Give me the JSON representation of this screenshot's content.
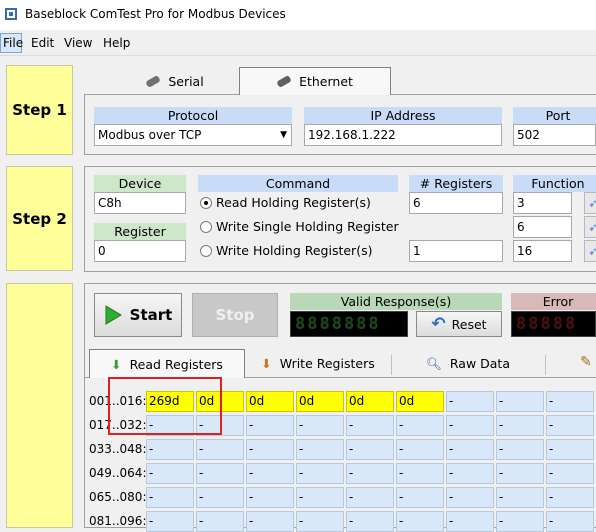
{
  "window": {
    "title": "Baseblock ComTest Pro for Modbus Devices"
  },
  "menu": {
    "file": "File",
    "edit": "Edit",
    "view": "View",
    "help": "Help"
  },
  "steps": {
    "step1": "Step 1",
    "step2": "Step 2"
  },
  "connection_tabs": {
    "serial": "Serial",
    "ethernet": "Ethernet"
  },
  "ethernet": {
    "protocol_label": "Protocol",
    "protocol_value": "Modbus over TCP",
    "ip_label": "IP Address",
    "ip_value": "192.168.1.222",
    "port_label": "Port",
    "port_value": "502"
  },
  "step2": {
    "device_label": "Device",
    "device_value": "C8h",
    "register_label": "Register",
    "register_value": "0",
    "command_label": "Command",
    "commands": [
      "Read Holding Register(s)",
      "Write Single Holding Register",
      "Write Holding Register(s)"
    ],
    "selected_command": 0,
    "num_registers_label": "# Registers",
    "num_registers_read": "6",
    "num_registers_write_multi": "1",
    "function_label": "Function",
    "function_values": [
      "3",
      "6",
      "16"
    ]
  },
  "controls": {
    "start": "Start",
    "stop": "Stop",
    "reset": "Reset",
    "valid_response_label": "Valid Response(s)",
    "valid_response_digits": "8888888",
    "error_label": "Error",
    "error_digits": "88888"
  },
  "data_tabs": {
    "read": "Read Registers",
    "write": "Write Registers",
    "raw": "Raw Data"
  },
  "register_rows": [
    {
      "label": "001..016:",
      "values": [
        "269d",
        "0d",
        "0d",
        "0d",
        "0d",
        "0d",
        "-",
        "-",
        "-"
      ]
    },
    {
      "label": "017..032:",
      "values": [
        "-",
        "-",
        "-",
        "-",
        "-",
        "-",
        "-",
        "-",
        "-"
      ]
    },
    {
      "label": "033..048:",
      "values": [
        "-",
        "-",
        "-",
        "-",
        "-",
        "-",
        "-",
        "-",
        "-"
      ]
    },
    {
      "label": "049..064:",
      "values": [
        "-",
        "-",
        "-",
        "-",
        "-",
        "-",
        "-",
        "-",
        "-"
      ]
    },
    {
      "label": "065..080:",
      "values": [
        "-",
        "-",
        "-",
        "-",
        "-",
        "-",
        "-",
        "-",
        "-"
      ]
    },
    {
      "label": "081..096:",
      "values": [
        "-",
        "-",
        "-",
        "-",
        "-",
        "-",
        "-",
        "-",
        "-"
      ]
    }
  ],
  "colors": {
    "highlight": "#ffff00",
    "cell_bg": "#d8e8f8",
    "step_bg": "#ffff99",
    "annotation": "#e02020"
  }
}
